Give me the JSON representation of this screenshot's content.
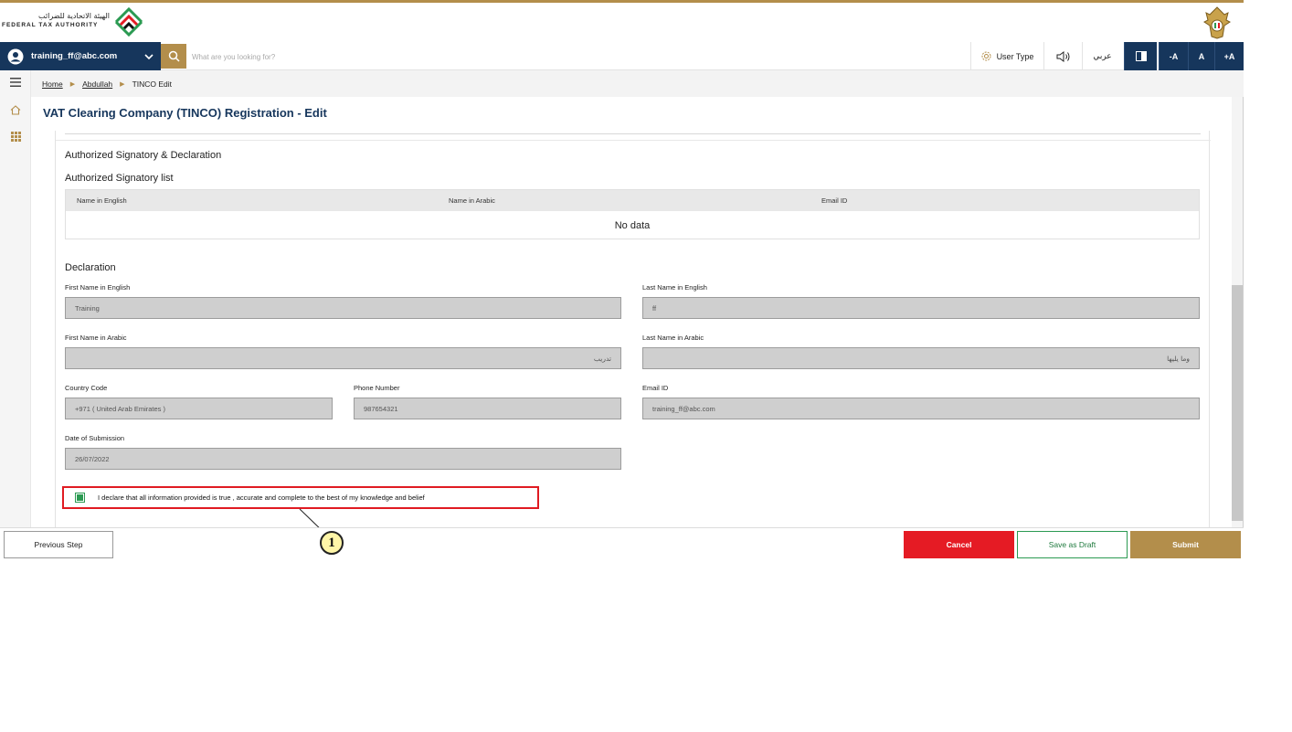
{
  "header": {
    "logo_arabic": "الهيئة الاتحادية للضرائب",
    "logo_english": "FEDERAL TAX AUTHORITY"
  },
  "toolbar": {
    "user_email": "training_ff@abc.com",
    "search_placeholder": "What are you looking for?",
    "user_type_label": "User Type",
    "language_label": "عربي",
    "font_decrease": "-A",
    "font_normal": "A",
    "font_increase": "+A"
  },
  "breadcrumb": {
    "items": [
      "Home",
      "Abdullah",
      "TINCO Edit"
    ]
  },
  "page": {
    "title": "VAT Clearing Company (TINCO) Registration - Edit"
  },
  "form": {
    "section_title": "Authorized Signatory & Declaration",
    "list_title": "Authorized Signatory list",
    "table": {
      "columns": [
        "Name in English",
        "Name in Arabic",
        "Email ID"
      ],
      "empty_text": "No data"
    },
    "declaration_title": "Declaration",
    "fields": {
      "first_name_en_label": "First Name in English",
      "first_name_en_value": "Training",
      "last_name_en_label": "Last Name in English",
      "last_name_en_value": "ff",
      "first_name_ar_label": "First Name in Arabic",
      "first_name_ar_value": "تدريب",
      "last_name_ar_label": "Last Name in Arabic",
      "last_name_ar_value": "وما يليها",
      "country_code_label": "Country Code",
      "country_code_value": "+971 ( United Arab Emirates )",
      "phone_label": "Phone Number",
      "phone_value": "987654321",
      "email_label": "Email ID",
      "email_value": "training_ff@abc.com",
      "submission_date_label": "Date of Submission",
      "submission_date_value": "26/07/2022"
    },
    "declaration_text": "I declare that all information provided is true , accurate and complete to the best of my knowledge and belief",
    "declaration_checked": true
  },
  "annotation": {
    "callout_number": "1"
  },
  "footer": {
    "previous_label": "Previous Step",
    "cancel_label": "Cancel",
    "draft_label": "Save as Draft",
    "submit_label": "Submit"
  },
  "colors": {
    "navy": "#16365c",
    "gold": "#b38e4b",
    "red": "#e51b24",
    "green": "#2b9a52"
  }
}
